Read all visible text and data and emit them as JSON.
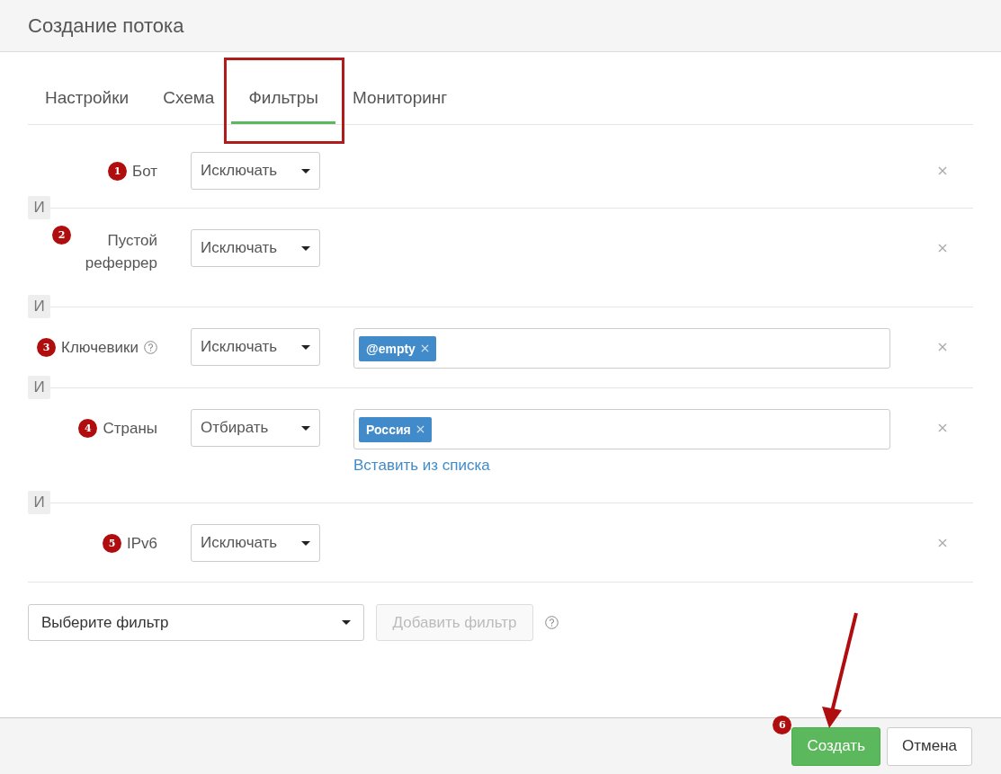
{
  "dialog": {
    "title": "Создание потока"
  },
  "tabs": [
    {
      "label": "Настройки",
      "selected": false,
      "highlighted": false
    },
    {
      "label": "Схема",
      "selected": false,
      "highlighted": false
    },
    {
      "label": "Фильтры",
      "selected": true,
      "highlighted": true
    },
    {
      "label": "Мониторинг",
      "selected": false,
      "highlighted": false
    }
  ],
  "filters": [
    {
      "number": "1",
      "label": "Бот",
      "help": false,
      "mode": "Исключать",
      "kind": "plain"
    },
    {
      "join": "И",
      "number": "2",
      "label": "Пустой реферрер",
      "help": false,
      "mode": "Исключать",
      "kind": "plain"
    },
    {
      "join": "И",
      "number": "3",
      "label": "Ключевики",
      "help": true,
      "mode": "Исключать",
      "kind": "tags",
      "tags": [
        "@empty"
      ]
    },
    {
      "join": "И",
      "number": "4",
      "label": "Страны",
      "help": false,
      "mode": "Отбирать",
      "kind": "tags",
      "tags": [
        "Россия"
      ],
      "link": "Вставить из списка"
    },
    {
      "join": "И",
      "number": "5",
      "label": "IPv6",
      "help": false,
      "mode": "Исключать",
      "kind": "plain"
    }
  ],
  "add_filter": {
    "placeholder": "Выберите фильтр",
    "button": "Добавить фильтр",
    "disabled": true
  },
  "buttons": [
    {
      "label": "Создать",
      "kind": "primary",
      "number": "6"
    },
    {
      "label": "Отмена",
      "kind": "default"
    }
  ]
}
